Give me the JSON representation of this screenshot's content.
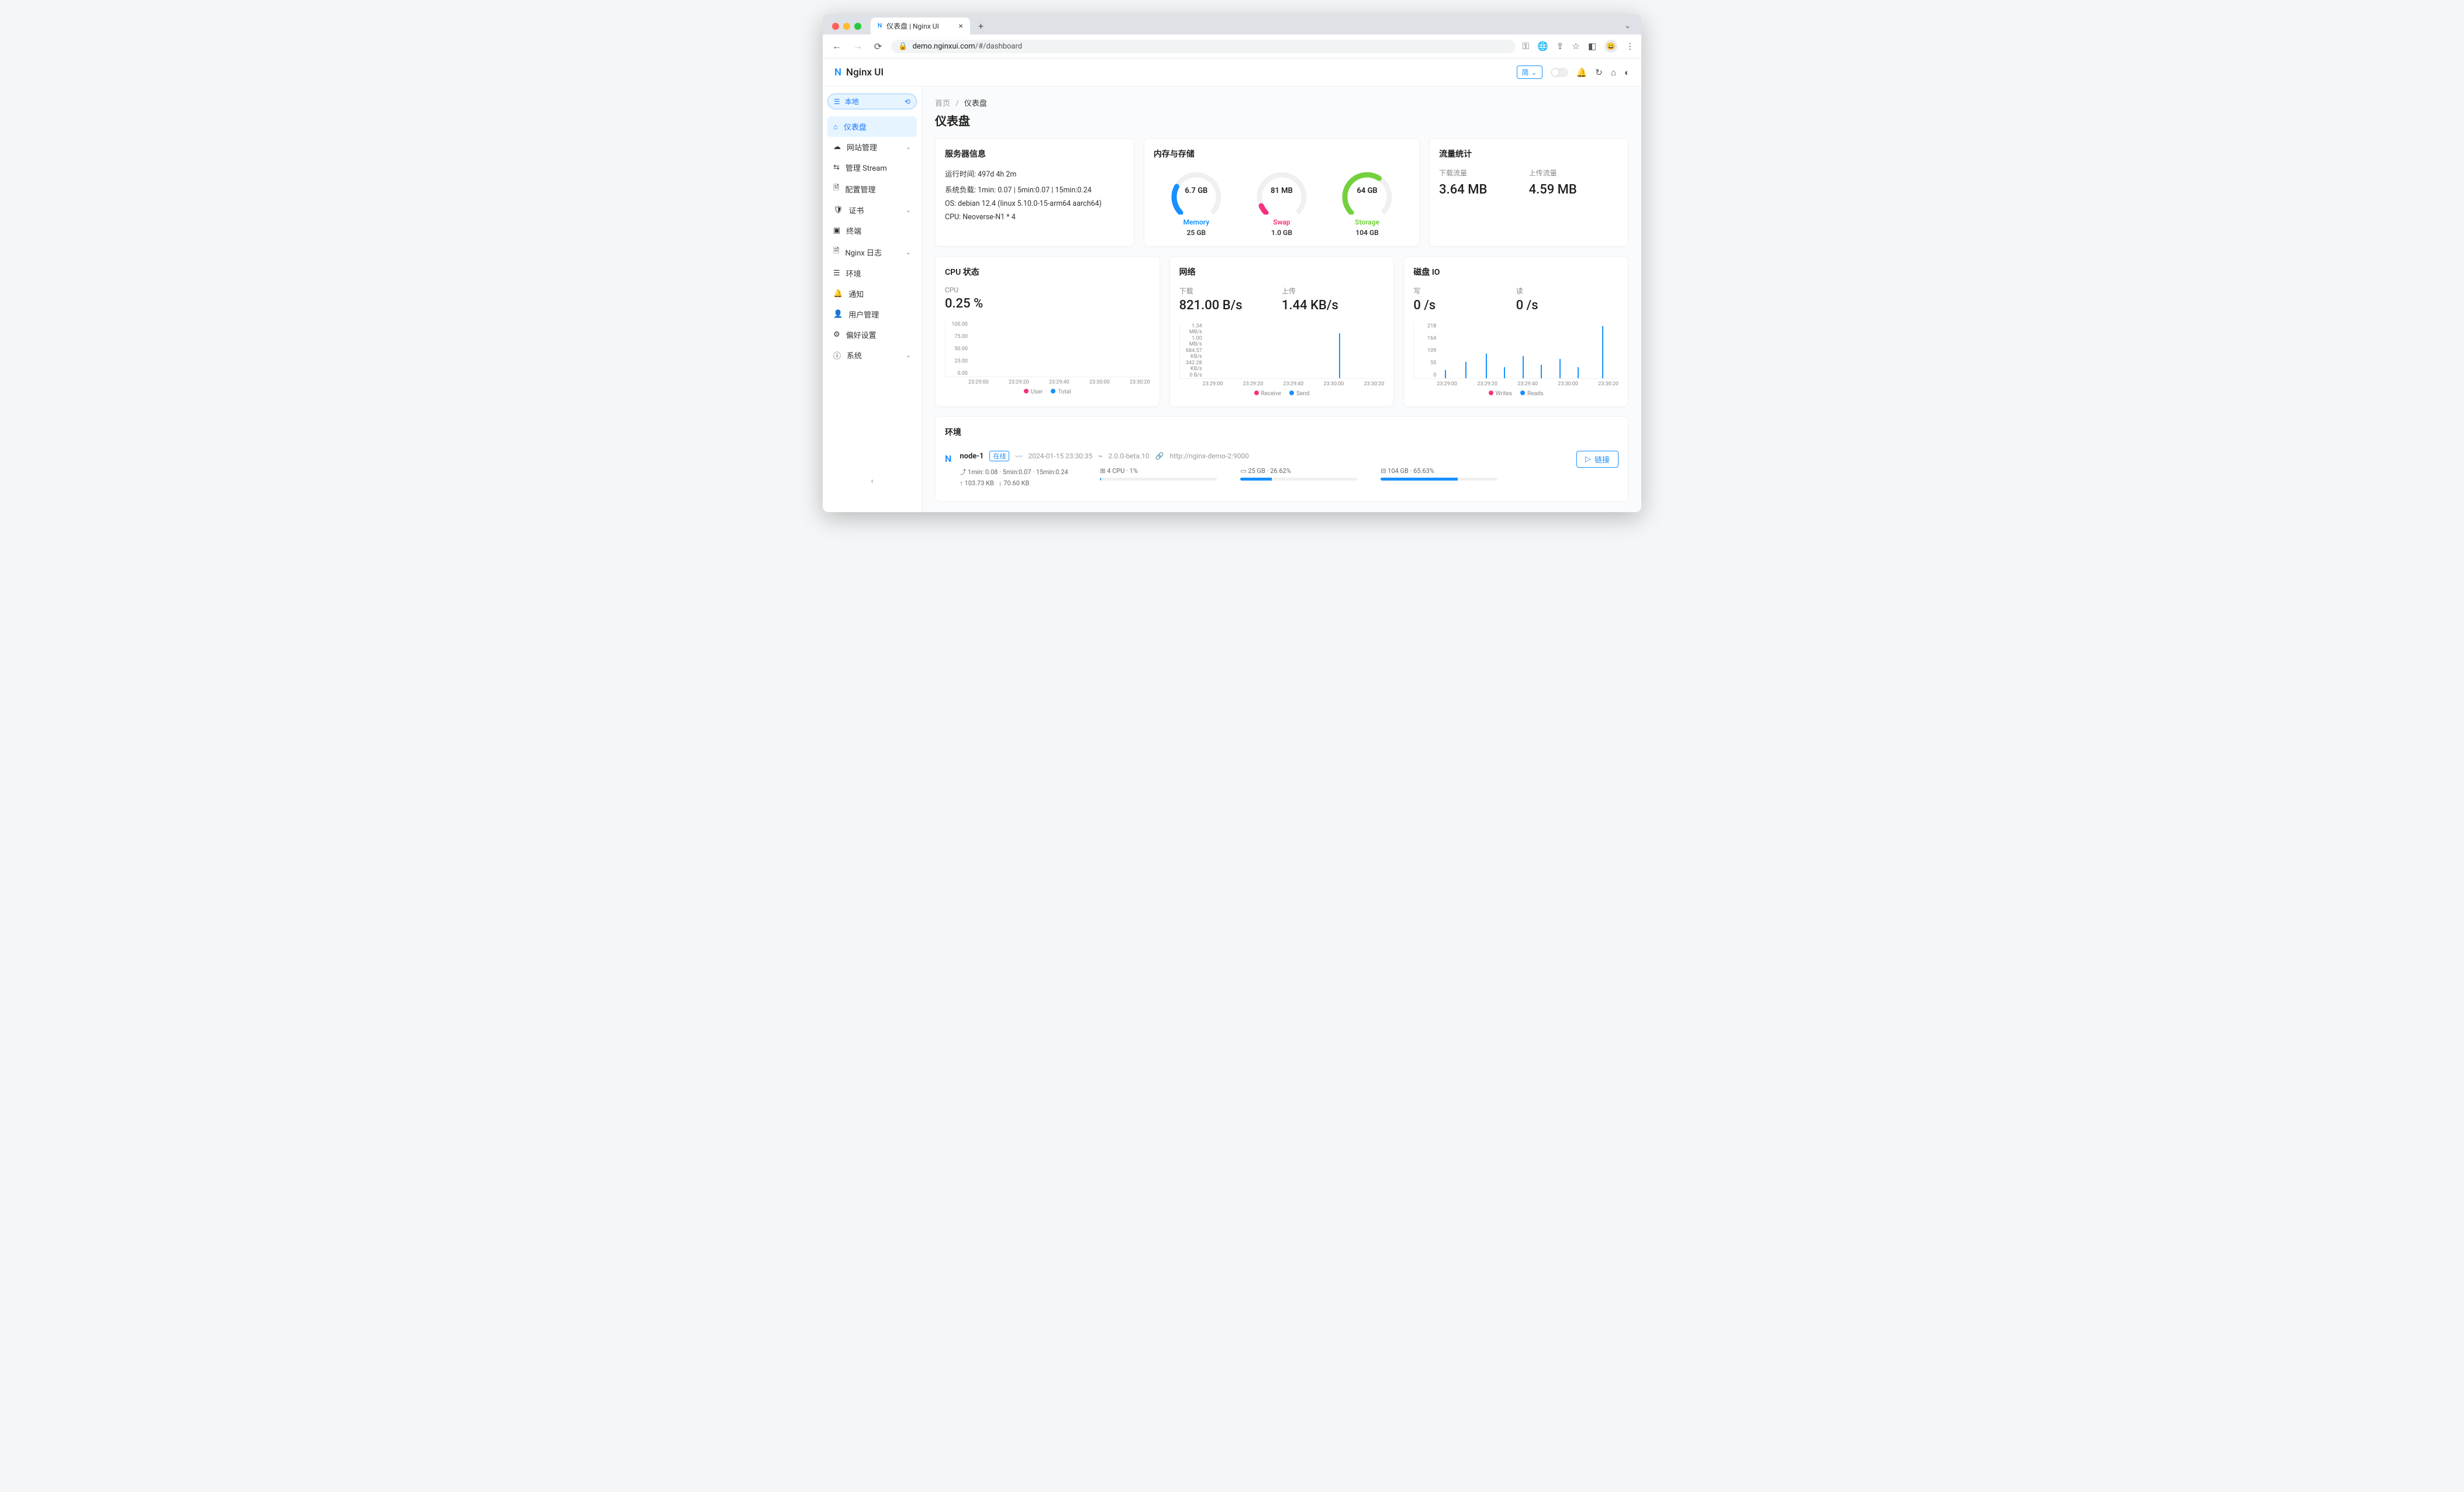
{
  "browser": {
    "tab_title": "仪表盘 | Nginx UI",
    "url_domain": "demo.nginxui.com",
    "url_path": "/#/dashboard"
  },
  "header": {
    "brand": "Nginx UI",
    "lang": "简"
  },
  "sidebar": {
    "env_label": "本地",
    "items": [
      {
        "icon": "⌂",
        "label": "仪表盘",
        "active": true
      },
      {
        "icon": "☁",
        "label": "网站管理",
        "chev": true
      },
      {
        "icon": "⇆",
        "label": "管理 Stream"
      },
      {
        "icon": "🗎",
        "label": "配置管理"
      },
      {
        "icon": "🛡",
        "label": "证书",
        "chev": true
      },
      {
        "icon": "▣",
        "label": "终端"
      },
      {
        "icon": "🗎",
        "label": "Nginx 日志",
        "chev": true
      },
      {
        "icon": "☰",
        "label": "环境"
      },
      {
        "icon": "🔔",
        "label": "通知"
      },
      {
        "icon": "👤",
        "label": "用户管理"
      },
      {
        "icon": "⚙",
        "label": "偏好设置"
      },
      {
        "icon": "ⓘ",
        "label": "系统",
        "chev": true
      }
    ]
  },
  "breadcrumb": {
    "home": "首页",
    "current": "仪表盘"
  },
  "page_title": "仪表盘",
  "server_info": {
    "title": "服务器信息",
    "uptime_label": "运行时间:",
    "uptime_value": "497d 4h 2m",
    "load_label": "系统负载:",
    "load_value": "1min: 0.07 | 5min:0.07 | 15min:0.24",
    "os_label": "OS:",
    "os_value": "debian 12.4 (linux 5.10.0-15-arm64 aarch64)",
    "cpu_label": "CPU:",
    "cpu_value": "Neoverse-N1 * 4"
  },
  "mem_storage": {
    "title": "内存与存储",
    "memory": {
      "used": "6.7 GB",
      "label": "Memory",
      "total": "25 GB",
      "percent": 27,
      "color": "#1890ff"
    },
    "swap": {
      "used": "81 MB",
      "label": "Swap",
      "total": "1.0 GB",
      "percent": 8,
      "color": "#f5317f"
    },
    "storage": {
      "used": "64 GB",
      "label": "Storage",
      "total": "104 GB",
      "percent": 62,
      "color": "#73d13d"
    }
  },
  "traffic": {
    "title": "流量统计",
    "down_label": "下载流量",
    "down_value": "3.64 MB",
    "up_label": "上传流量",
    "up_value": "4.59 MB"
  },
  "cpu_card": {
    "title": "CPU 状态",
    "label": "CPU",
    "value": "0.25 %",
    "legend": {
      "user": "User",
      "total": "Total",
      "user_color": "#f5317f",
      "total_color": "#1890ff"
    }
  },
  "net_card": {
    "title": "网络",
    "down_label": "下载",
    "down_value": "821.00 B/s",
    "up_label": "上传",
    "up_value": "1.44 KB/s",
    "legend": {
      "receive": "Receive",
      "send": "Send",
      "receive_color": "#f5317f",
      "send_color": "#1890ff"
    }
  },
  "disk_card": {
    "title": "磁盘 IO",
    "write_label": "写",
    "write_value": "0 /s",
    "read_label": "读",
    "read_value": "0 /s",
    "legend": {
      "writes": "Writes",
      "reads": "Reads",
      "writes_color": "#f5317f",
      "reads_color": "#1890ff"
    }
  },
  "chart_data": [
    {
      "type": "line",
      "title": "CPU",
      "ylim": [
        0,
        100
      ],
      "y_ticks": [
        "100.00",
        "75.00",
        "50.00",
        "25.00",
        "0.00"
      ],
      "x_ticks": [
        "23:29:00",
        "23:29:20",
        "23:29:40",
        "23:30:00",
        "23:30:20"
      ],
      "series": [
        {
          "name": "User",
          "color": "#f5317f"
        },
        {
          "name": "Total",
          "color": "#1890ff"
        }
      ],
      "values_approx": "near 0 across range with tiny spikes ~1-2%"
    },
    {
      "type": "line",
      "title": "Network",
      "y_ticks": [
        "1.34 MB/s",
        "1.00 MB/s",
        "684.57 KB/s",
        "342.28 KB/s",
        "0 B/s"
      ],
      "x_ticks": [
        "23:29:00",
        "23:29:20",
        "23:29:40",
        "23:30:00",
        "23:30:20"
      ],
      "series": [
        {
          "name": "Receive",
          "color": "#f5317f"
        },
        {
          "name": "Send",
          "color": "#1890ff"
        }
      ],
      "values_approx": "flat near 0 with single spike ~1.1 MB/s around 23:30:05"
    },
    {
      "type": "line",
      "title": "Disk IO",
      "y_ticks": [
        "218",
        "164",
        "109",
        "55",
        "0"
      ],
      "x_ticks": [
        "23:29:00",
        "23:29:20",
        "23:29:40",
        "23:30:00",
        "23:30:20"
      ],
      "series": [
        {
          "name": "Writes",
          "color": "#f5317f"
        },
        {
          "name": "Reads",
          "color": "#1890ff"
        }
      ],
      "values_approx": "periodic small spikes 20-100, one spike ~210 near 23:30:25"
    }
  ],
  "env": {
    "title": "环境",
    "node": {
      "name": "node-1",
      "status": "在线",
      "time": "2024-01-15 23:30:35",
      "version": "2.0.0-beta.10",
      "url": "http://nginx-demo-2:9000",
      "load": "1min: 0.08 · 5min:0.07 · 15min:0.24",
      "net_up": "103.73 KB",
      "net_down": "70.60 KB",
      "cpu": "4 CPU · 1%",
      "cpu_pct": 1,
      "mem": "25 GB · 26.62%",
      "mem_pct": 26.62,
      "disk": "104 GB · 65.63%",
      "disk_pct": 65.63,
      "link_btn": "链接"
    }
  }
}
